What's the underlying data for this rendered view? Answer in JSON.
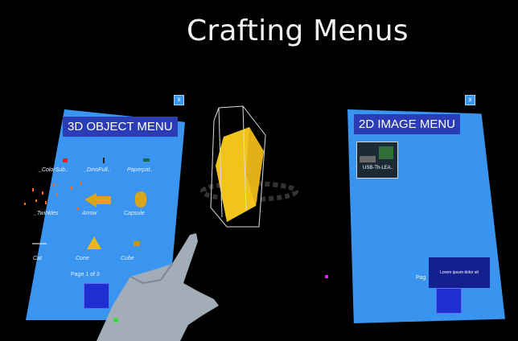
{
  "scene_title": "Crafting Menus",
  "left_menu": {
    "title": "3D OBJECT MENU",
    "close_icon": "x",
    "items": [
      {
        "label": "_ColorSub..",
        "icon": "color-sub-icon"
      },
      {
        "label": "_DinoFull..",
        "icon": "dino-full-icon"
      },
      {
        "label": "Paperpat..",
        "icon": "paperpat-icon"
      },
      {
        "label": "_Twinkles",
        "icon": "twinkles-icon"
      },
      {
        "label": "Arrow",
        "icon": "arrow-icon"
      },
      {
        "label": "Capsule",
        "icon": "capsule-icon"
      },
      {
        "label": "Cat",
        "icon": "cat-icon"
      },
      {
        "label": "Cone",
        "icon": "cone-icon"
      },
      {
        "label": "Cube",
        "icon": "cube-icon"
      }
    ],
    "page_text": "Page 1 of 3"
  },
  "right_menu": {
    "title": "2D IMAGE MENU",
    "close_icon": "x",
    "thumbnail_label": "USB-Th-LEA..",
    "card_text": "Lorem ipsum dolor sit",
    "page_text": "Pag"
  },
  "colors": {
    "panel": "#3a95f0",
    "header": "#2b3cb7",
    "hand": "#9aa7b3",
    "object": "#f0c419"
  }
}
